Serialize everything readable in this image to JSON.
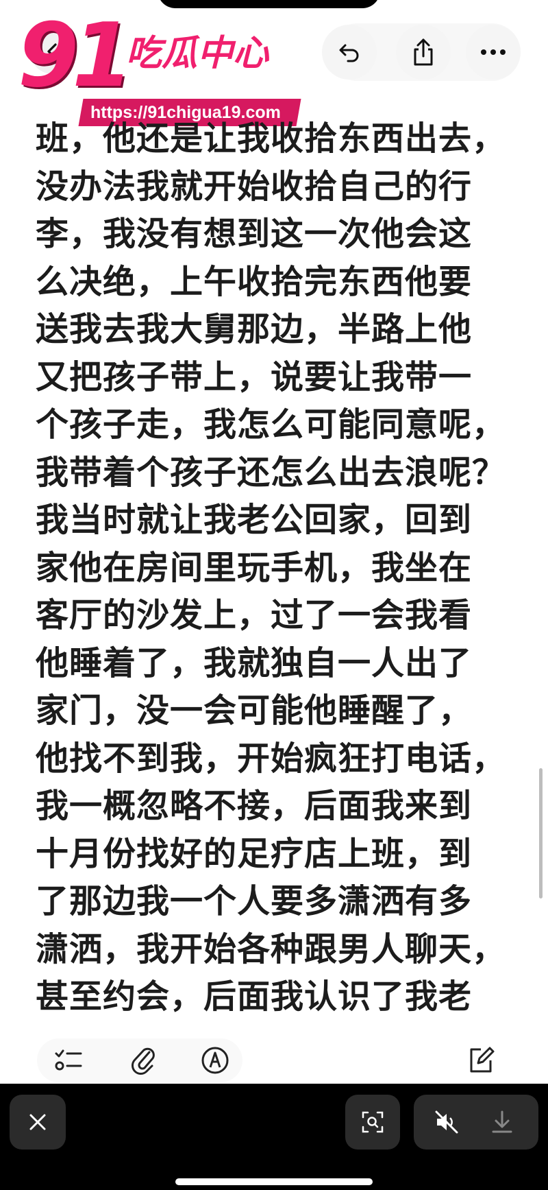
{
  "watermark": {
    "number": "91",
    "title": "吃瓜中心",
    "url": "https://91chigua19.com"
  },
  "topbar": {
    "back_icon": "chevron-left-icon",
    "undo_icon": "undo-icon",
    "share_icon": "share-icon",
    "more_icon": "more-icon"
  },
  "content": {
    "lines": [
      "班，他还是让我收拾东西出去，",
      "没办法我就开始收拾自己的行",
      "李，我没有想到这一次他会这",
      "么决绝，上午收拾完东西他要",
      "送我去我大舅那边，半路上他",
      "又把孩子带上，说要让我带一",
      "个孩子走，我怎么可能同意呢，",
      "我带着个孩子还怎么出去浪呢？",
      "我当时就让我老公回家，回到",
      "家他在房间里玩手机，我坐在",
      "客厅的沙发上，过了一会我看",
      "他睡着了，我就独自一人出了",
      "家门，没一会可能他睡醒了，",
      "他找不到我，开始疯狂打电话，",
      "我一概忽略不接，后面我来到",
      "十月份找好的足疗店上班，到",
      "了那边我一个人要多潇洒有多",
      "潇洒，我开始各种跟男人聊天，",
      "甚至约会，后面我认识了我老"
    ]
  },
  "edit_toolbar": {
    "checklist_icon": "checklist-icon",
    "attach_icon": "paperclip-icon",
    "markup_icon": "markup-pen-icon",
    "compose_icon": "compose-icon"
  },
  "viewer_bar": {
    "close_icon": "close-icon",
    "live_text_icon": "live-text-icon",
    "mute_icon": "speaker-muted-icon",
    "download_icon": "download-icon"
  },
  "colors": {
    "watermark_pink": "#f0206e",
    "url_bg": "#d6195f",
    "text": "#1c1c1c",
    "viewer_bar_bg": "#000000"
  }
}
